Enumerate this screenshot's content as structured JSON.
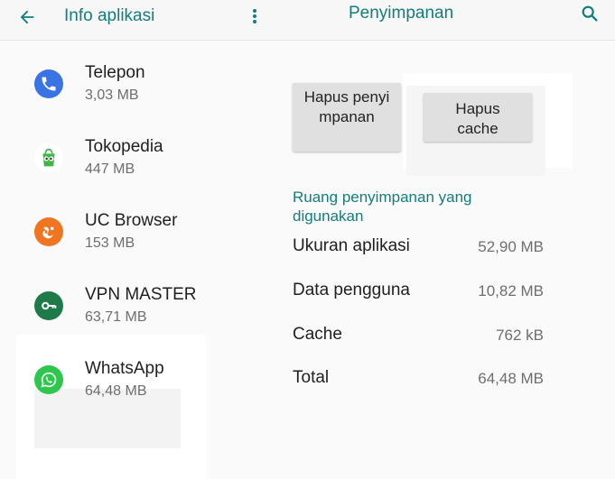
{
  "header": {
    "left_title": "Info aplikasi",
    "right_title": "Penyimpanan",
    "back_icon": "arrow-back-icon",
    "menu_icon": "more-vert-icon",
    "search_icon": "search-icon",
    "accent_color": "#127e7b"
  },
  "apps": [
    {
      "name": "Telepon",
      "size": "3,03 MB",
      "icon": "phone-icon",
      "color": "#3a73e6"
    },
    {
      "name": "Tokopedia",
      "size": "447 MB",
      "icon": "tokopedia-icon",
      "color": "#42b549"
    },
    {
      "name": "UC Browser",
      "size": "153 MB",
      "icon": "uc-browser-icon",
      "color": "#f07521"
    },
    {
      "name": "VPN MASTER",
      "size": "63,71 MB",
      "icon": "vpn-key-icon",
      "color": "#1f7a4a"
    },
    {
      "name": "WhatsApp",
      "size": "64,48 MB",
      "icon": "whatsapp-icon",
      "color": "#2cc74c"
    }
  ],
  "storage": {
    "clear_storage_label": "Hapus penyimpanan",
    "clear_cache_label": "Hapus cache",
    "section_title": "Ruang penyimpanan yang digunakan",
    "rows": [
      {
        "label": "Ukuran aplikasi",
        "value": "52,90 MB"
      },
      {
        "label": "Data pengguna",
        "value": "10,82 MB"
      },
      {
        "label": "Cache",
        "value": "762 kB"
      },
      {
        "label": "Total",
        "value": "64,48 MB"
      }
    ]
  }
}
